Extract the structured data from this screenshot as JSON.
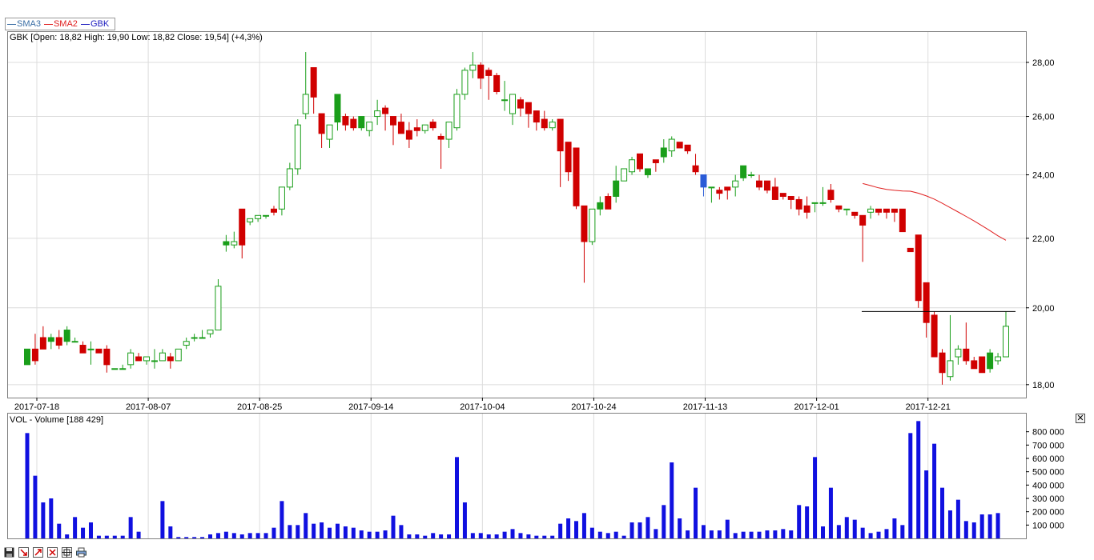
{
  "legend": [
    {
      "name": "SMA3",
      "color": "#3a6ea5"
    },
    {
      "name": "SMA2",
      "color": "#e02020"
    },
    {
      "name": "GBK",
      "color": "#2020c0"
    }
  ],
  "price_header": "GBK [Open: 18,82  High: 19,90  Low: 18,82  Close: 19,54] (+4,3%)",
  "volume_header": "VOL - Volume [188 429]",
  "close_pane_label": "✕",
  "colors": {
    "up": "#1a9e1a",
    "down": "#d00000",
    "volume": "#1010e0",
    "sma2": "#e02020",
    "grid": "#dcdcdc",
    "level_line": "#000000",
    "special": "#2a5bd7"
  },
  "toolbar_icons": [
    "save-icon",
    "draw-down-icon",
    "draw-up-icon",
    "draw-both-icon",
    "crosshair-icon",
    "print-icon"
  ],
  "chart_data": [
    {
      "type": "candlestick",
      "ticker": "GBK",
      "x_labels": [
        "2017-07-18",
        "2017-08-07",
        "2017-08-25",
        "2017-09-14",
        "2017-10-04",
        "2017-10-24",
        "2017-11-13",
        "2017-12-01",
        "2017-12-21"
      ],
      "y_ticks": [
        "18,00",
        "20,00",
        "22,00",
        "24,00",
        "26,00",
        "28,00"
      ],
      "y_scale": "log",
      "ylim": [
        17.8,
        29.0
      ],
      "reference_line": 19.9,
      "candles": [
        [
          18.5,
          18.9,
          18.5,
          18.9
        ],
        [
          18.9,
          19.3,
          18.5,
          18.6
        ],
        [
          19.2,
          19.5,
          18.9,
          18.9
        ],
        [
          19.1,
          19.3,
          18.9,
          19.2
        ],
        [
          19.2,
          19.4,
          18.9,
          19.0
        ],
        [
          19.1,
          19.5,
          19.0,
          19.4
        ],
        [
          19.1,
          19.2,
          19.1,
          19.1
        ],
        [
          19.0,
          19.1,
          18.9,
          18.8
        ],
        [
          18.9,
          19.1,
          18.5,
          18.9
        ],
        [
          18.9,
          18.9,
          18.8,
          18.8
        ],
        [
          18.9,
          19.0,
          18.3,
          18.5
        ],
        [
          18.4,
          18.4,
          18.4,
          18.4
        ],
        [
          18.4,
          18.5,
          18.4,
          18.4
        ],
        [
          18.5,
          18.9,
          18.4,
          18.8
        ],
        [
          18.7,
          18.8,
          18.6,
          18.6
        ],
        [
          18.6,
          18.7,
          18.5,
          18.7
        ],
        [
          18.6,
          18.9,
          18.4,
          18.6
        ],
        [
          18.6,
          18.9,
          18.6,
          18.8
        ],
        [
          18.7,
          18.8,
          18.4,
          18.6
        ],
        [
          18.6,
          18.9,
          18.6,
          18.9
        ],
        [
          19.0,
          19.2,
          18.9,
          19.1
        ],
        [
          19.2,
          19.3,
          19.1,
          19.2
        ],
        [
          19.2,
          19.4,
          19.2,
          19.2
        ],
        [
          19.3,
          19.4,
          19.2,
          19.4
        ],
        [
          19.4,
          20.8,
          19.4,
          20.6
        ],
        [
          21.8,
          22.1,
          21.6,
          21.9
        ],
        [
          21.8,
          22.2,
          21.7,
          21.9
        ],
        [
          22.9,
          22.9,
          21.4,
          21.8
        ],
        [
          22.5,
          22.5,
          22.4,
          22.6
        ],
        [
          22.6,
          22.7,
          22.5,
          22.7
        ],
        [
          22.7,
          22.7,
          22.6,
          22.7
        ],
        [
          22.9,
          23.0,
          22.7,
          22.8
        ],
        [
          22.9,
          23.3,
          22.7,
          23.6
        ],
        [
          23.6,
          24.4,
          23.5,
          24.2
        ],
        [
          24.2,
          25.9,
          24.0,
          25.7
        ],
        [
          26.1,
          28.4,
          25.9,
          26.8
        ],
        [
          27.8,
          27.8,
          26.1,
          26.7
        ],
        [
          26.1,
          26.1,
          24.9,
          25.4
        ],
        [
          25.2,
          25.5,
          24.9,
          25.7
        ],
        [
          25.8,
          26.5,
          25.5,
          26.8
        ],
        [
          26.0,
          26.1,
          25.5,
          25.7
        ],
        [
          25.9,
          26.0,
          25.5,
          25.6
        ],
        [
          25.6,
          25.6,
          25.5,
          26.0
        ],
        [
          25.5,
          25.7,
          25.3,
          25.8
        ],
        [
          26.0,
          26.6,
          25.7,
          26.2
        ],
        [
          26.3,
          26.4,
          25.5,
          26.1
        ],
        [
          26.0,
          26.0,
          25.0,
          25.7
        ],
        [
          25.8,
          26.1,
          25.5,
          25.4
        ],
        [
          25.5,
          25.8,
          24.9,
          25.2
        ],
        [
          25.6,
          25.9,
          25.3,
          25.5
        ],
        [
          25.5,
          25.6,
          25.4,
          25.7
        ],
        [
          25.8,
          25.9,
          25.5,
          25.6
        ],
        [
          25.3,
          25.4,
          24.2,
          25.2
        ],
        [
          25.2,
          25.8,
          24.9,
          25.8
        ],
        [
          25.6,
          27.0,
          25.5,
          26.8
        ],
        [
          26.8,
          27.8,
          26.6,
          27.7
        ],
        [
          27.7,
          28.4,
          27.4,
          27.9
        ],
        [
          27.9,
          28.0,
          27.0,
          27.4
        ],
        [
          27.7,
          27.8,
          26.6,
          27.5
        ],
        [
          27.5,
          27.6,
          26.8,
          26.9
        ],
        [
          26.6,
          27.3,
          26.2,
          26.6
        ],
        [
          26.1,
          26.8,
          25.7,
          26.8
        ],
        [
          26.6,
          26.7,
          26.0,
          26.3
        ],
        [
          26.5,
          26.5,
          25.6,
          26.1
        ],
        [
          26.2,
          26.2,
          25.5,
          25.8
        ],
        [
          25.9,
          26.2,
          25.5,
          25.6
        ],
        [
          25.6,
          25.9,
          25.5,
          25.8
        ],
        [
          25.9,
          25.9,
          23.6,
          24.8
        ],
        [
          25.1,
          25.1,
          23.8,
          24.1
        ],
        [
          24.9,
          24.9,
          22.9,
          23.0
        ],
        [
          23.0,
          23.0,
          20.7,
          21.9
        ],
        [
          21.9,
          22.6,
          21.8,
          22.9
        ],
        [
          22.9,
          23.3,
          22.7,
          23.1
        ],
        [
          23.3,
          23.4,
          22.9,
          22.9
        ],
        [
          23.3,
          24.3,
          23.1,
          23.8
        ],
        [
          23.8,
          24.2,
          23.8,
          24.2
        ],
        [
          24.1,
          24.6,
          24.0,
          24.5
        ],
        [
          24.7,
          24.7,
          24.1,
          24.2
        ],
        [
          24.0,
          24.2,
          23.9,
          24.2
        ],
        [
          24.5,
          24.5,
          24.1,
          24.4
        ],
        [
          24.6,
          25.2,
          24.4,
          24.9
        ],
        [
          24.8,
          25.3,
          24.6,
          25.2
        ],
        [
          25.1,
          25.1,
          24.9,
          24.9
        ],
        [
          25.0,
          25.0,
          24.7,
          24.8
        ],
        [
          24.3,
          24.7,
          24.0,
          24.1
        ],
        [
          24.0,
          24.0,
          23.3,
          23.6
        ],
        [
          23.6,
          23.6,
          23.1,
          23.6
        ],
        [
          23.5,
          23.6,
          23.2,
          23.4
        ],
        [
          23.6,
          23.6,
          23.2,
          23.5
        ],
        [
          23.6,
          24.0,
          23.3,
          23.8
        ],
        [
          23.9,
          24.3,
          23.8,
          24.3
        ],
        [
          24.0,
          24.1,
          23.9,
          24.0
        ],
        [
          23.8,
          24.0,
          23.5,
          23.6
        ],
        [
          23.8,
          23.8,
          23.4,
          23.5
        ],
        [
          23.6,
          23.9,
          23.2,
          23.2
        ],
        [
          23.4,
          23.4,
          23.2,
          23.3
        ],
        [
          23.3,
          23.3,
          22.9,
          23.2
        ],
        [
          23.2,
          23.3,
          22.7,
          22.9
        ],
        [
          23.0,
          23.3,
          22.6,
          22.8
        ],
        [
          23.1,
          23.1,
          22.8,
          23.1
        ],
        [
          23.1,
          23.6,
          23.0,
          23.1
        ],
        [
          23.5,
          23.7,
          23.1,
          23.2
        ],
        [
          23.0,
          23.0,
          22.8,
          22.9
        ],
        [
          22.9,
          22.9,
          22.7,
          22.9
        ],
        [
          22.8,
          22.8,
          22.6,
          22.7
        ],
        [
          22.7,
          22.7,
          21.3,
          22.4
        ],
        [
          22.8,
          23.0,
          22.6,
          22.9
        ],
        [
          22.9,
          22.9,
          22.7,
          22.8
        ],
        [
          22.9,
          22.9,
          22.6,
          22.8
        ],
        [
          22.9,
          22.9,
          22.5,
          22.8
        ],
        [
          22.9,
          22.9,
          22.2,
          22.2
        ],
        [
          21.7,
          21.7,
          21.6,
          21.6
        ],
        [
          22.1,
          22.1,
          20.0,
          20.2
        ],
        [
          20.7,
          20.7,
          19.2,
          19.6
        ],
        [
          19.8,
          19.9,
          18.8,
          18.7
        ],
        [
          18.8,
          18.9,
          18.0,
          18.3
        ],
        [
          18.2,
          19.8,
          18.1,
          18.6
        ],
        [
          18.7,
          19.0,
          18.5,
          18.9
        ],
        [
          18.9,
          19.6,
          18.5,
          18.6
        ],
        [
          18.6,
          18.7,
          18.4,
          18.4
        ],
        [
          18.7,
          18.7,
          18.3,
          18.3
        ],
        [
          18.4,
          18.9,
          18.3,
          18.8
        ],
        [
          18.6,
          18.8,
          18.5,
          18.7
        ],
        [
          18.7,
          19.9,
          18.7,
          19.5
        ]
      ],
      "up_colors": [
        "hollow",
        "solid"
      ],
      "special_candles": [
        85
      ],
      "up_style": [
        1,
        0,
        0,
        1,
        0,
        1,
        0,
        0,
        0,
        0,
        0,
        0,
        0,
        0,
        0,
        0,
        0,
        0,
        0,
        0,
        0,
        0,
        0,
        0,
        0,
        1,
        0,
        0,
        0,
        0,
        0,
        0,
        0,
        0,
        0,
        0,
        0,
        0,
        0,
        1,
        0,
        0,
        1,
        0,
        0,
        0,
        0,
        0,
        0,
        0,
        0,
        0,
        0,
        0,
        0,
        0,
        0,
        0,
        1,
        0,
        0,
        0,
        0,
        0,
        0,
        0,
        0,
        0,
        0,
        0,
        0,
        0,
        1,
        0,
        1,
        0,
        0,
        0,
        1,
        0,
        1,
        0,
        0,
        0,
        0,
        0,
        0,
        0,
        0,
        0,
        1,
        0,
        0,
        0,
        0,
        0,
        0,
        0,
        0,
        0,
        0,
        0,
        0,
        0,
        0,
        0,
        0,
        0,
        0,
        0,
        0,
        0,
        0,
        0,
        0,
        0,
        0,
        0,
        0,
        0,
        0,
        1,
        0,
        0
      ]
    },
    {
      "type": "volume",
      "name": "VOL - Volume",
      "y_ticks": [
        "100 000",
        "200 000",
        "300 000",
        "400 000",
        "500 000",
        "600 000",
        "700 000",
        "800 000"
      ],
      "ylim": [
        0,
        900000
      ],
      "values": [
        790000,
        470000,
        270000,
        300000,
        110000,
        30000,
        160000,
        80000,
        120000,
        20000,
        20000,
        20000,
        20000,
        160000,
        50000,
        0,
        0,
        280000,
        90000,
        10000,
        10000,
        10000,
        10000,
        30000,
        40000,
        50000,
        40000,
        30000,
        40000,
        40000,
        40000,
        80000,
        280000,
        100000,
        100000,
        190000,
        110000,
        120000,
        80000,
        110000,
        90000,
        80000,
        60000,
        50000,
        50000,
        60000,
        170000,
        100000,
        30000,
        30000,
        20000,
        40000,
        30000,
        30000,
        610000,
        270000,
        40000,
        40000,
        30000,
        30000,
        50000,
        70000,
        40000,
        30000,
        20000,
        20000,
        20000,
        110000,
        150000,
        130000,
        190000,
        80000,
        50000,
        40000,
        50000,
        20000,
        120000,
        120000,
        160000,
        70000,
        250000,
        570000,
        150000,
        60000,
        380000,
        100000,
        60000,
        60000,
        140000,
        40000,
        50000,
        50000,
        50000,
        60000,
        60000,
        70000,
        60000,
        250000,
        240000,
        610000,
        90000,
        380000,
        100000,
        160000,
        140000,
        80000,
        40000,
        50000,
        70000,
        150000,
        100000,
        790000,
        880000,
        510000,
        710000,
        380000,
        210000,
        290000,
        130000,
        120000,
        180000,
        180000,
        190000
      ]
    }
  ]
}
